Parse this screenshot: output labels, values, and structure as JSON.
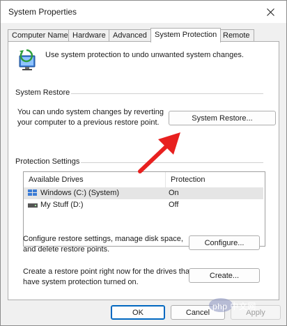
{
  "window": {
    "title": "System Properties"
  },
  "tabs": [
    {
      "label": "Computer Name"
    },
    {
      "label": "Hardware"
    },
    {
      "label": "Advanced"
    },
    {
      "label": "System Protection"
    },
    {
      "label": "Remote"
    }
  ],
  "intro": {
    "text": "Use system protection to undo unwanted system changes."
  },
  "system_restore": {
    "heading": "System Restore",
    "desc_line1": "You can undo system changes by reverting",
    "desc_line2": "your computer to a previous restore point.",
    "button": "System Restore..."
  },
  "protection": {
    "heading": "Protection Settings",
    "col_drives": "Available Drives",
    "col_protection": "Protection",
    "rows": [
      {
        "drive": "Windows (C:) (System)",
        "protection": "On"
      },
      {
        "drive": "My Stuff (D:)",
        "protection": "Off"
      }
    ]
  },
  "configure": {
    "line1": "Configure restore settings, manage disk space,",
    "line2": "and delete restore points.",
    "button": "Configure..."
  },
  "create": {
    "line1": "Create a restore point right now for the drives that",
    "line2": "have system protection turned on.",
    "button": "Create..."
  },
  "footer": {
    "ok": "OK",
    "cancel": "Cancel",
    "apply": "Apply"
  },
  "watermark": {
    "text": "php 中文网"
  },
  "colors": {
    "accent": "#0067c0",
    "arrow": "#e8201f"
  }
}
